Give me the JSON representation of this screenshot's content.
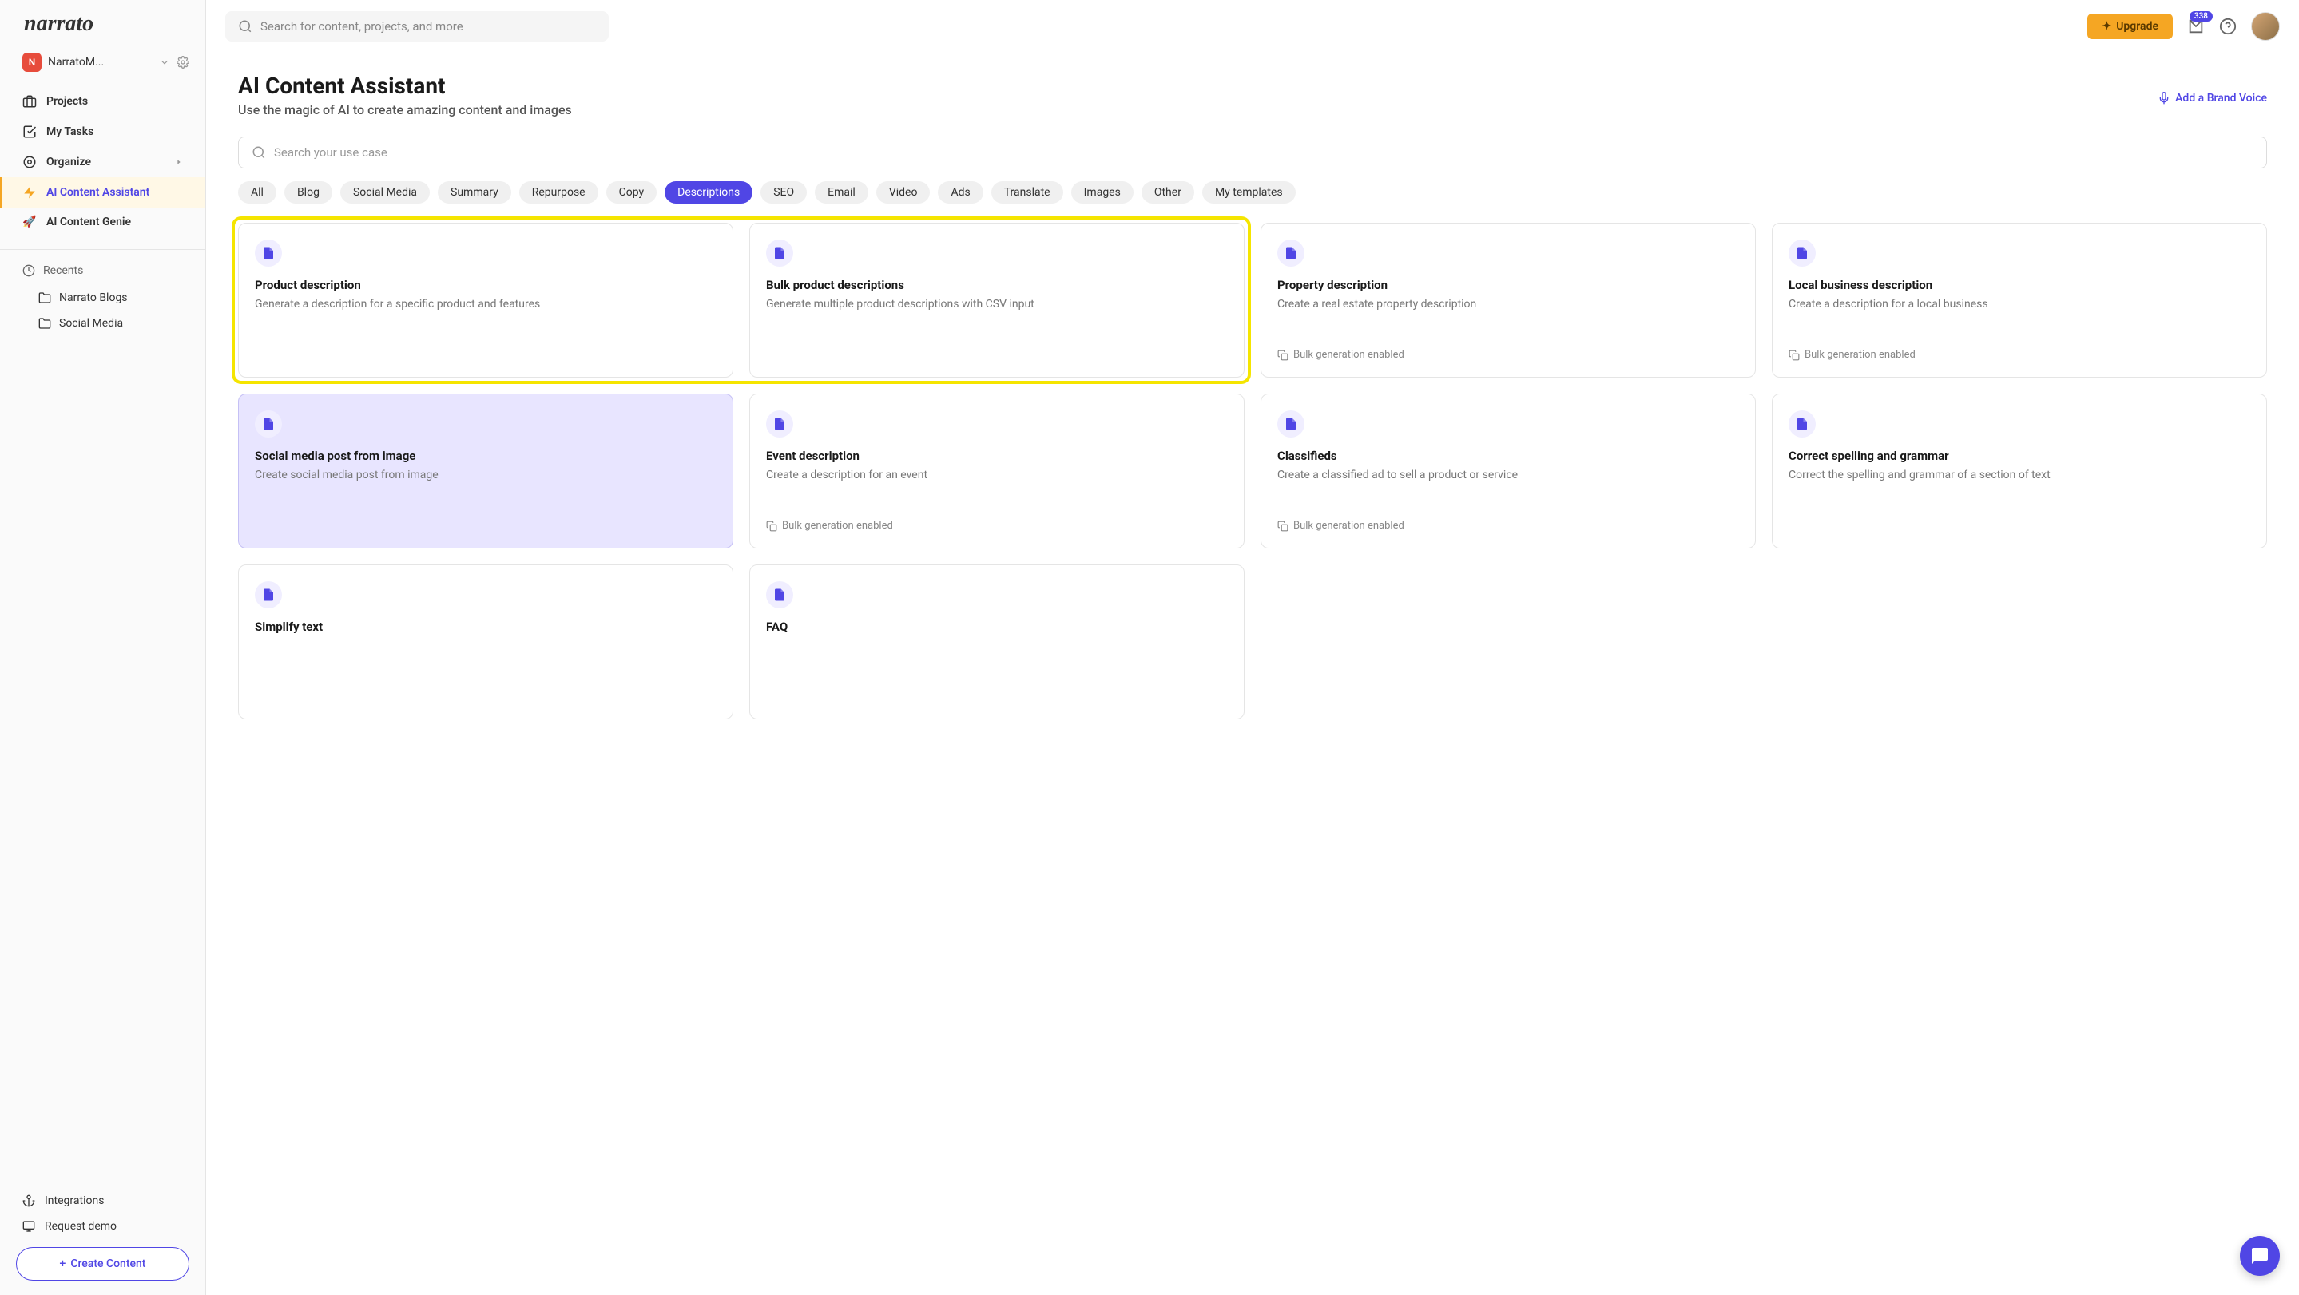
{
  "logo": "narrato",
  "workspace": {
    "initial": "N",
    "name": "NarratoM..."
  },
  "topbar": {
    "search_placeholder": "Search for content, projects, and more",
    "upgrade": "Upgrade",
    "badge": "338"
  },
  "nav": {
    "projects": "Projects",
    "mytasks": "My Tasks",
    "organize": "Organize",
    "assistant": "AI Content Assistant",
    "genie": "AI Content Genie"
  },
  "recents": {
    "header": "Recents",
    "items": [
      "Narrato Blogs",
      "Social Media"
    ]
  },
  "bottom": {
    "integrations": "Integrations",
    "request_demo": "Request demo",
    "create": "Create Content"
  },
  "page": {
    "title": "AI Content Assistant",
    "subtitle": "Use the magic of AI to create amazing content and images",
    "brand_voice": "Add a Brand Voice",
    "usecase_placeholder": "Search your use case"
  },
  "filters": [
    "All",
    "Blog",
    "Social Media",
    "Summary",
    "Repurpose",
    "Copy",
    "Descriptions",
    "SEO",
    "Email",
    "Video",
    "Ads",
    "Translate",
    "Images",
    "Other",
    "My templates"
  ],
  "active_filter": "Descriptions",
  "bulk_label": "Bulk generation enabled",
  "cards": [
    {
      "title": "Product description",
      "desc": "Generate a description for a specific product and features",
      "highlighted": true
    },
    {
      "title": "Bulk product descriptions",
      "desc": "Generate multiple product descriptions with CSV input",
      "highlighted": true
    },
    {
      "title": "Property description",
      "desc": "Create a real estate property description",
      "bulk": true
    },
    {
      "title": "Local business description",
      "desc": "Create a description for a local business",
      "bulk": true
    },
    {
      "title": "Social media post from image",
      "desc": "Create social media post from image",
      "selected": true
    },
    {
      "title": "Event description",
      "desc": "Create a description for an event",
      "bulk": true
    },
    {
      "title": "Classifieds",
      "desc": "Create a classified ad to sell a product or service",
      "bulk": true
    },
    {
      "title": "Correct spelling and grammar",
      "desc": "Correct the spelling and grammar of a section of text"
    },
    {
      "title": "Simplify text",
      "desc": ""
    },
    {
      "title": "FAQ",
      "desc": ""
    }
  ]
}
